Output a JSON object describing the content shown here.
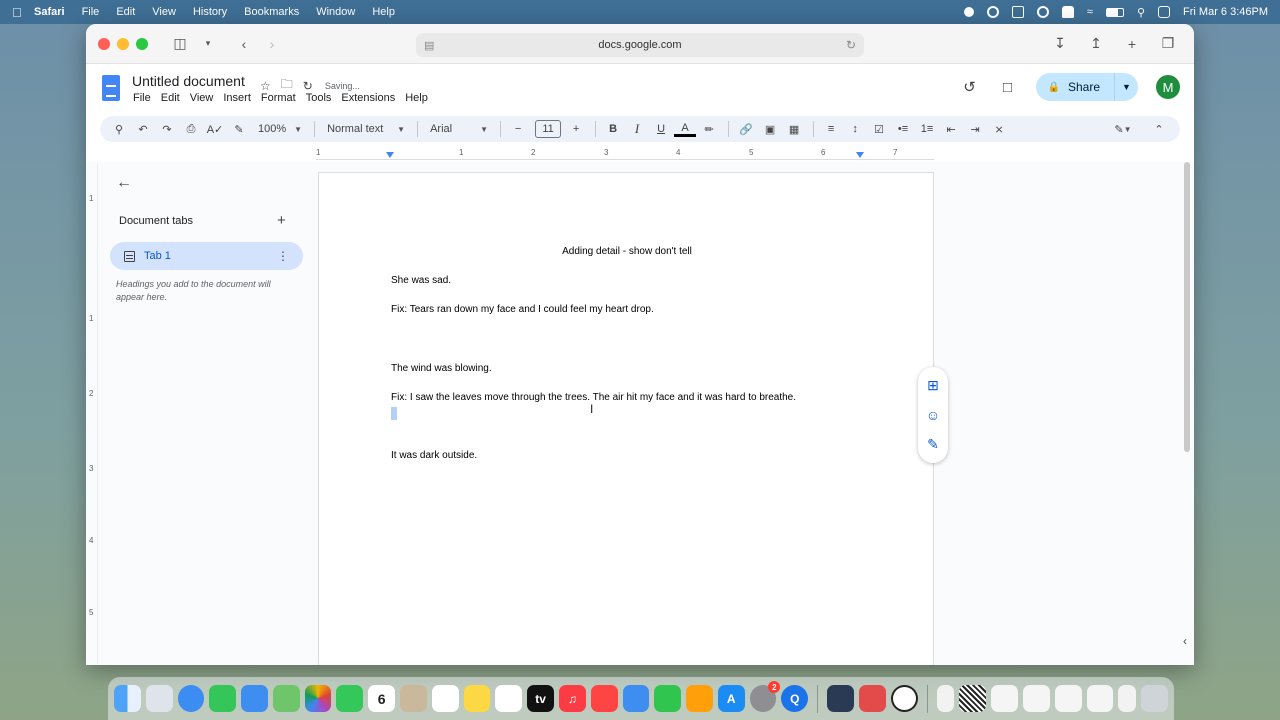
{
  "menubar": {
    "app": "Safari",
    "items": [
      "File",
      "Edit",
      "View",
      "History",
      "Bookmarks",
      "Window",
      "Help"
    ],
    "clock": "Fri Mar 6  3:46PM"
  },
  "browser": {
    "url": "docs.google.com"
  },
  "docs": {
    "title": "Untitled document",
    "status": "Saving...",
    "menu": [
      "File",
      "Edit",
      "View",
      "Insert",
      "Format",
      "Tools",
      "Extensions",
      "Help"
    ],
    "share_label": "Share",
    "avatar_letter": "M"
  },
  "toolbar": {
    "zoom": "100%",
    "style": "Normal text",
    "font": "Arial",
    "font_size": "11"
  },
  "ruler": {
    "numbers": [
      "1",
      "1",
      "2",
      "3",
      "4",
      "5",
      "6",
      "7"
    ]
  },
  "vruler": {
    "numbers": [
      "1",
      "1",
      "2",
      "3",
      "4",
      "5"
    ]
  },
  "sidepanel": {
    "heading": "Document tabs",
    "tab_label": "Tab 1",
    "hint": "Headings you add to the document will appear here."
  },
  "document": {
    "heading": "Adding detail - show don't tell",
    "lines": [
      "She was sad.",
      "Fix: Tears ran down my face and I could feel my heart drop.",
      "The wind was blowing.",
      "Fix: I saw the leaves move through the trees. The air hit my face and it was hard to breathe.",
      "It was dark outside."
    ]
  },
  "dock": {
    "calendar_day": "6",
    "settings_badge": "2",
    "tv_label": "tv"
  },
  "colors": {
    "accent": "#0b57d0",
    "share_bg": "#c2e7ff",
    "toolbar_bg": "#edf2fa",
    "menubar_bg": "#3f6f95"
  }
}
